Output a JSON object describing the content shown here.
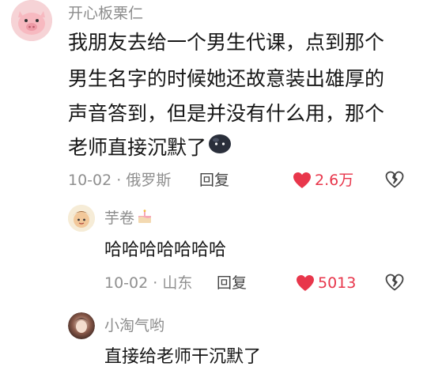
{
  "colors": {
    "like": "#e8364b",
    "meta": "#8f8f8f",
    "name": "#8c8c8c",
    "text": "#161616"
  },
  "comment": {
    "username": "开心板栗仁",
    "lines": [
      "我朋友去给一个男生代课，点到那个",
      "男生名字的时候她还故意装出雄厚的",
      "声音答到，但是并没有什么用，那个",
      "老师直接沉默了"
    ],
    "emoji": "dark-blob-emoji",
    "date": "10-02 · 俄罗斯",
    "reply_label": "回复",
    "likes": "2.6万",
    "avatar_icon": "pig-avatar"
  },
  "replies": [
    {
      "username": "芋卷",
      "badge_icon": "cake-icon",
      "text": "哈哈哈哈哈哈哈",
      "date": "10-02 · 山东",
      "reply_label": "回复",
      "likes": "5013",
      "avatar_icon": "cartoon-avatar"
    },
    {
      "username": "小淘气哟",
      "text": "直接给老师干沉默了",
      "avatar_icon": "photo-avatar"
    }
  ]
}
